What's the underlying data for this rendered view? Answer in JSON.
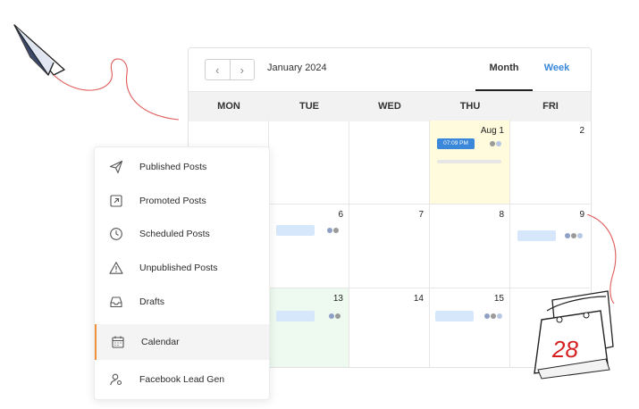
{
  "calendar": {
    "month_label": "January 2024",
    "prev_icon": "chevron-left-icon",
    "next_icon": "chevron-right-icon",
    "view_tabs": {
      "month": "Month",
      "week": "Week",
      "active": "Month"
    },
    "day_headers": [
      "MON",
      "TUE",
      "WED",
      "THU",
      "FRI"
    ],
    "week1": {
      "thu_date": "Aug 1",
      "thu_time": "07:09 PM",
      "fri_date": "2"
    },
    "week2": {
      "tue": "6",
      "wed": "7",
      "thu": "8",
      "fri": "9"
    },
    "week3": {
      "tue": "13",
      "wed": "14",
      "thu": "15"
    },
    "colors": {
      "accent": "#3b87d9",
      "today_bg": "#fffbdc",
      "green_bg": "#eefaef",
      "post_bar": "#d6e7fb"
    }
  },
  "menu": {
    "items": [
      {
        "label": "Published Posts",
        "icon": "paper-plane-icon"
      },
      {
        "label": "Promoted Posts",
        "icon": "arrow-up-right-box-icon"
      },
      {
        "label": "Scheduled Posts",
        "icon": "clock-icon"
      },
      {
        "label": "Unpublished Posts",
        "icon": "warning-triangle-icon"
      },
      {
        "label": "Drafts",
        "icon": "inbox-tray-icon"
      },
      {
        "label": "Calendar",
        "icon": "calendar-icon",
        "active": true
      },
      {
        "label": "Facebook Lead Gen",
        "icon": "user-gear-icon"
      }
    ],
    "active_color": "#f0923a"
  },
  "decorations": {
    "paper_plane": "paper-plane-illustration-icon",
    "calendar_page": "tear-off-calendar-illustration-icon",
    "calendar_page_number": "28"
  }
}
